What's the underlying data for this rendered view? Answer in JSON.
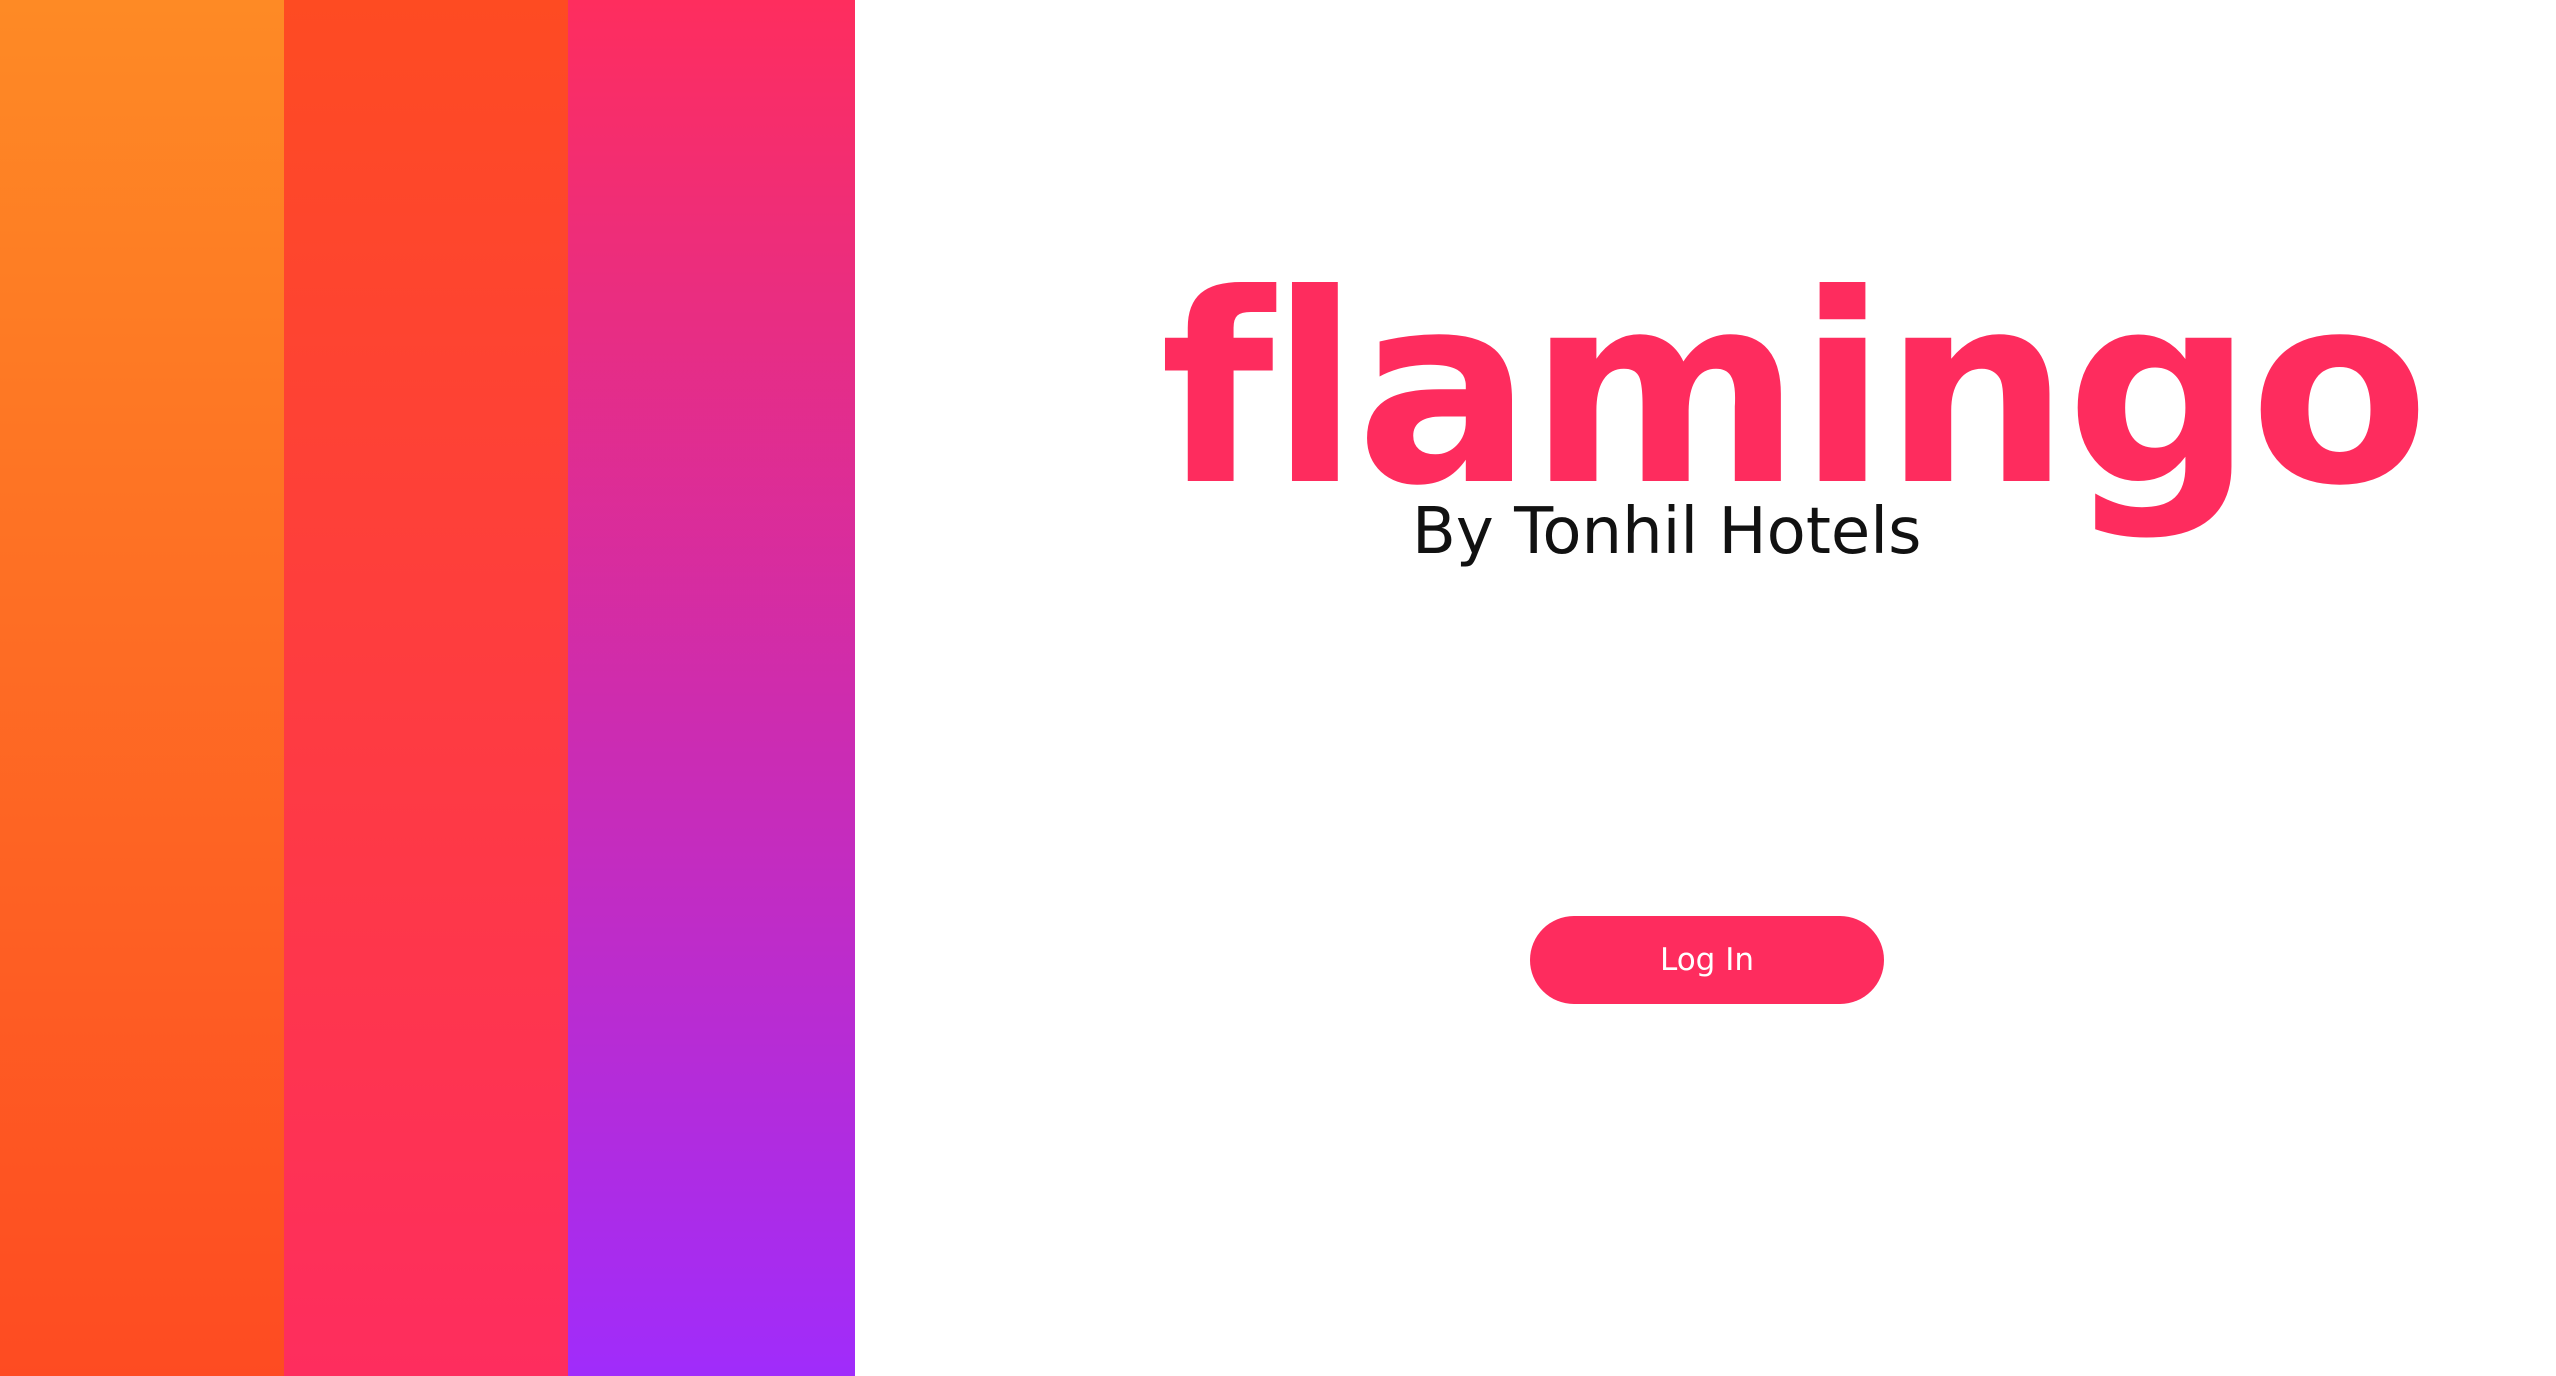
{
  "brand": {
    "logo_text": "flamingo",
    "tagline": "By Tonhil Hotels",
    "accent_color": "#fe2c5e"
  },
  "stripes": {
    "colors": [
      "#fe8a25",
      "#fe4b22",
      "#fe2d5e",
      "#a02cfb"
    ]
  },
  "actions": {
    "login_label": "Log In"
  }
}
